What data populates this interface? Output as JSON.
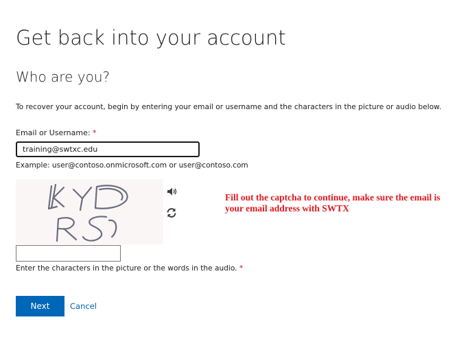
{
  "page": {
    "title": "Get back into your account",
    "subtitle": "Who are you?",
    "instructions": "To recover your account, begin by entering your email or username and the characters in the picture or audio below."
  },
  "email_field": {
    "label": "Email or Username:",
    "required_marker": "*",
    "value": "training@swtxc.edu",
    "example": "Example: user@contoso.onmicrosoft.com or user@contoso.com"
  },
  "captcha": {
    "image_text": "KYDRS",
    "audio_icon": "speaker-icon",
    "refresh_icon": "refresh-icon",
    "input_value": "",
    "help_text": "Enter the characters in the picture or the words in the audio.",
    "required_marker": "*"
  },
  "annotation": {
    "text": "Fill out the captcha to continue, make sure the email is your email address with SWTX",
    "color": "#e0191e"
  },
  "actions": {
    "next_label": "Next",
    "cancel_label": "Cancel"
  },
  "colors": {
    "primary": "#0067b8",
    "required": "#c50f1f"
  }
}
